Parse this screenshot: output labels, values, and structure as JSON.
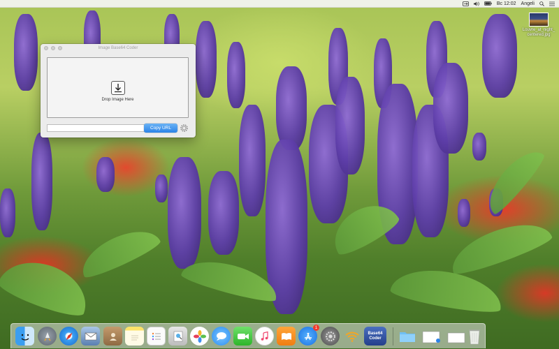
{
  "menubar": {
    "time": "Вс 12:02",
    "user": "Angeli"
  },
  "desktop": {
    "file_name": "Louvre_at_night_ centered.jpg"
  },
  "window": {
    "title": "Image Base64 Coder",
    "drop_label": "Drop Image Here",
    "url_value": "",
    "copy_button_label": "Copy URL",
    "copy_button_color": "#2b83e8"
  },
  "dock": {
    "apps": [
      {
        "name": "finder-icon"
      },
      {
        "name": "launchpad-icon"
      },
      {
        "name": "safari-icon"
      },
      {
        "name": "mail-icon"
      },
      {
        "name": "contacts-icon"
      },
      {
        "name": "notes-icon"
      },
      {
        "name": "reminders-icon"
      },
      {
        "name": "preview-icon"
      },
      {
        "name": "photos-icon"
      },
      {
        "name": "messages-icon"
      },
      {
        "name": "facetime-icon"
      },
      {
        "name": "itunes-icon"
      },
      {
        "name": "ibooks-icon"
      },
      {
        "name": "app-store-icon",
        "badge": "1"
      },
      {
        "name": "system-preferences-icon"
      },
      {
        "name": "wifi-icon"
      },
      {
        "name": "base64-coder-icon",
        "label": "Base64 Coder"
      },
      {
        "name": "folder-icon"
      },
      {
        "name": "document-icon"
      },
      {
        "name": "trash-icon"
      }
    ]
  }
}
